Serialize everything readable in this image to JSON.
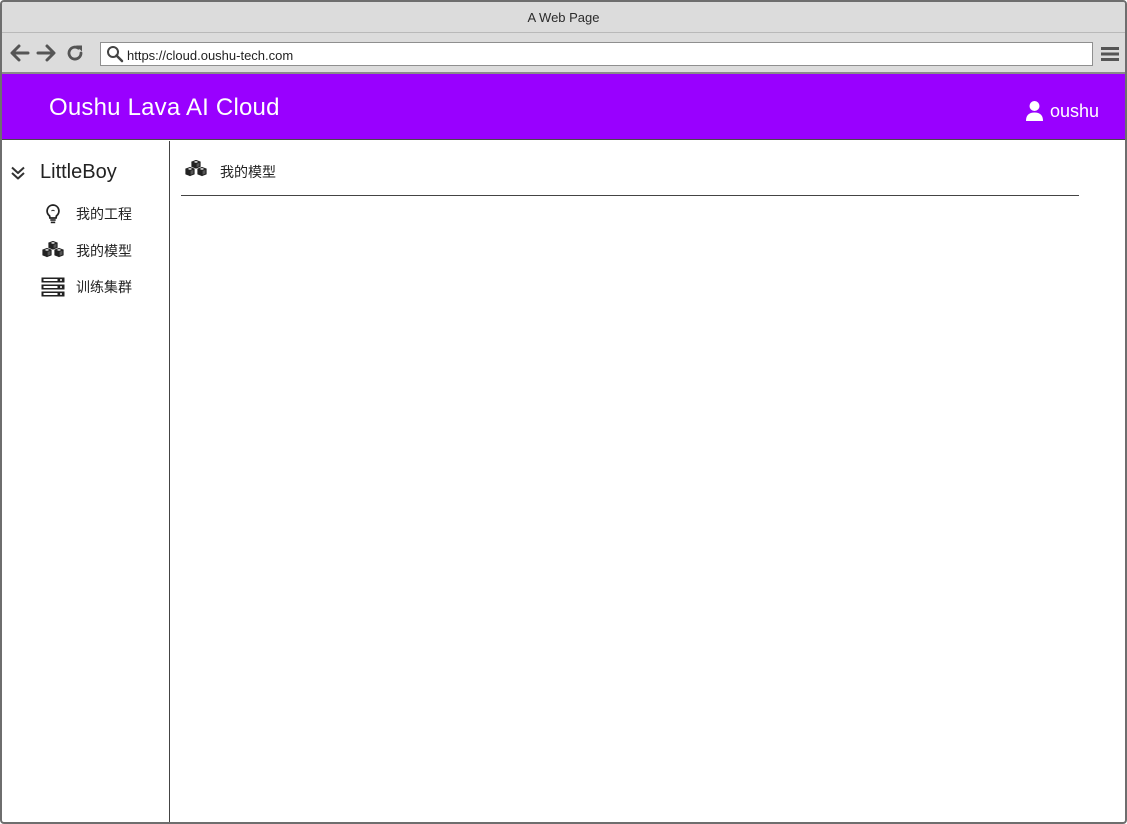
{
  "browser": {
    "window_title": "A Web Page",
    "url": "https://cloud.oushu-tech.com",
    "icons": {
      "back": "arrow-left-icon",
      "forward": "arrow-right-icon",
      "reload": "reload-icon",
      "search": "search-icon",
      "menu": "hamburger-menu-icon"
    }
  },
  "header": {
    "app_title": "Oushu Lava AI Cloud",
    "user_name": "oushu",
    "user_icon": "user-icon",
    "background_color": "#9900ff"
  },
  "sidebar": {
    "project_name": "LittleBoy",
    "project_icon": "double-chevron-down-icon",
    "items": [
      {
        "label": "我的工程",
        "icon": "lightbulb-icon"
      },
      {
        "label": "我的模型",
        "icon": "cubes-icon"
      },
      {
        "label": "训练集群",
        "icon": "server-icon"
      }
    ]
  },
  "main": {
    "title": "我的模型",
    "title_icon": "cubes-icon"
  }
}
